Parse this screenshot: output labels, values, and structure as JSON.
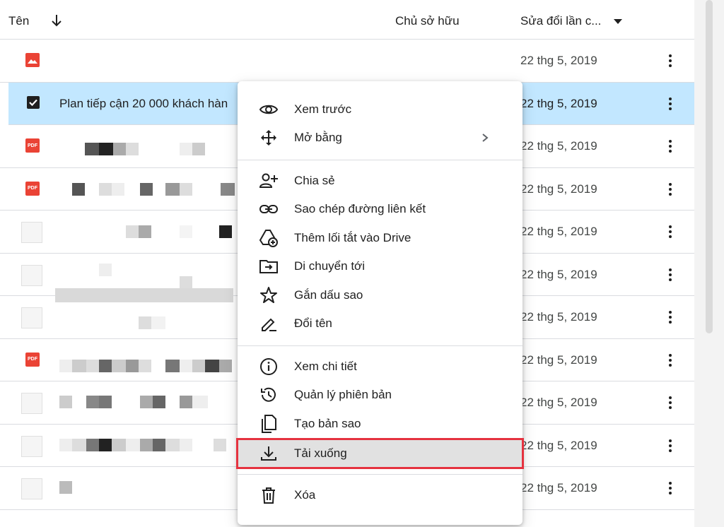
{
  "header": {
    "name_label": "Tên",
    "owner_label": "Chủ sở hữu",
    "modified_label": "Sửa đổi lần c..."
  },
  "rows": [
    {
      "type": "image",
      "title": "",
      "date": "22 thg 5, 2019"
    },
    {
      "type": "selected",
      "title": "Plan tiếp cận 20 000 khách hàn",
      "date": "22 thg 5, 2019"
    },
    {
      "type": "pdf",
      "title": "",
      "date": "22 thg 5, 2019",
      "icon_text": "PDF"
    },
    {
      "type": "pdf",
      "title": "",
      "date": "22 thg 5, 2019",
      "icon_text": "PDF"
    },
    {
      "type": "thumb",
      "title": "",
      "date": "22 thg 5, 2019"
    },
    {
      "type": "thumb",
      "title": "",
      "date": "22 thg 5, 2019"
    },
    {
      "type": "thumb",
      "title": "",
      "date": "22 thg 5, 2019"
    },
    {
      "type": "pdf",
      "title": "",
      "date": "22 thg 5, 2019",
      "icon_text": "PDF"
    },
    {
      "type": "thumb",
      "title": "",
      "date": "22 thg 5, 2019"
    },
    {
      "type": "thumb",
      "title": "",
      "date": "22 thg 5, 2019"
    },
    {
      "type": "thumb",
      "title": "",
      "date": "22 thg 5, 2019"
    }
  ],
  "menu": {
    "items": [
      {
        "label": "Xem trước",
        "icon": "eye-icon"
      },
      {
        "label": "Mở bằng",
        "icon": "open-with-icon"
      },
      {
        "label": "Chia sẻ",
        "icon": "share-person-icon"
      },
      {
        "label": "Sao chép đường liên kết",
        "icon": "link-icon"
      },
      {
        "label": "Thêm lối tắt vào Drive",
        "icon": "add-shortcut-icon"
      },
      {
        "label": "Di chuyển tới",
        "icon": "move-folder-icon"
      },
      {
        "label": "Gắn dấu sao",
        "icon": "star-icon"
      },
      {
        "label": "Đổi tên",
        "icon": "rename-pencil-icon"
      },
      {
        "label": "Xem chi tiết",
        "icon": "info-icon"
      },
      {
        "label": "Quản lý phiên bản",
        "icon": "history-icon"
      },
      {
        "label": "Tạo bản sao",
        "icon": "copy-icon"
      },
      {
        "label": "Tải xuống",
        "icon": "download-icon"
      },
      {
        "label": "Xóa",
        "icon": "trash-icon"
      }
    ]
  },
  "colors": {
    "selected_row": "#c2e7ff",
    "highlight_outline": "#e5323f",
    "pdf_red": "#ea4335"
  }
}
